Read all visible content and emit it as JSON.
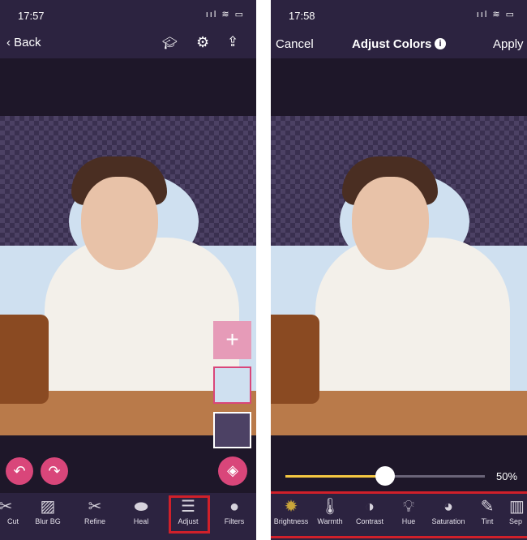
{
  "left": {
    "status_time": "17:57",
    "back_label": "Back",
    "icons": [
      "graduation-cap-icon",
      "gear-icon",
      "share-icon"
    ],
    "tools": [
      {
        "label": "Cut",
        "icon": "scissors-icon"
      },
      {
        "label": "Blur BG",
        "icon": "blur-icon"
      },
      {
        "label": "Refine",
        "icon": "refine-icon"
      },
      {
        "label": "Heal",
        "icon": "bandage-icon"
      },
      {
        "label": "Adjust",
        "icon": "sliders-icon"
      },
      {
        "label": "Filters",
        "icon": "filters-icon"
      }
    ],
    "partial_cut_label": "ut"
  },
  "right": {
    "status_time": "17:58",
    "cancel_label": "Cancel",
    "title": "Adjust Colors",
    "apply_label": "Apply",
    "slider": {
      "value_percent": 50,
      "label": "50%"
    },
    "tools": [
      {
        "label": "Brightness",
        "icon": "sun-icon"
      },
      {
        "label": "Warmth",
        "icon": "thermometer-icon"
      },
      {
        "label": "Contrast",
        "icon": "contrast-icon"
      },
      {
        "label": "Hue",
        "icon": "bulb-icon"
      },
      {
        "label": "Saturation",
        "icon": "gauge-icon"
      },
      {
        "label": "Tint",
        "icon": "dropper-icon"
      },
      {
        "label": "Sep",
        "icon": "film-icon"
      }
    ]
  },
  "colors": {
    "accent": "#d9467a",
    "slider": "#f5c842",
    "highlight": "#d0202a"
  }
}
